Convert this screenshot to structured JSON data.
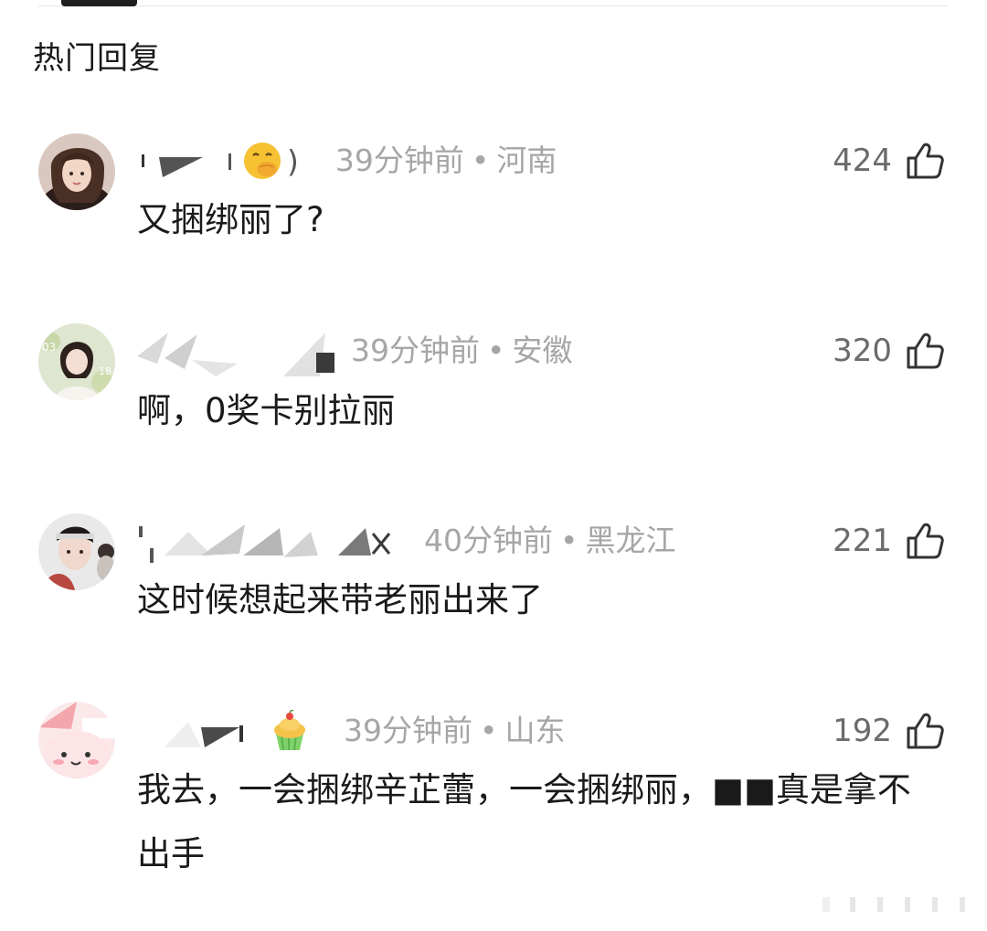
{
  "section_title": "热门回复",
  "comments": [
    {
      "time": "39分钟前",
      "dot": "•",
      "location": "河南",
      "likes": "424",
      "text": "又捆绑丽了?",
      "avatar_desc": "woman-long-hair-avatar",
      "username_emoji": "hand-over-mouth-emoji"
    },
    {
      "time": "39分钟前",
      "dot": "•",
      "location": "安徽",
      "likes": "320",
      "text": "啊，0奖卡别拉丽",
      "avatar_desc": "girl-portrait-avatar"
    },
    {
      "time": "40分钟前",
      "dot": "•",
      "location": "黑龙江",
      "likes": "221",
      "text": "这时候想起来带老丽出来了",
      "avatar_desc": "young-man-headband-avatar"
    },
    {
      "time": "39分钟前",
      "dot": "•",
      "location": "山东",
      "likes": "192",
      "text": "我去，一会捆绑辛芷蕾，一会捆绑丽，■■真是拿不出手",
      "avatar_desc": "pink-cartoon-avatar",
      "username_emoji": "cupcake-emoji"
    }
  ],
  "colors": {
    "meta_gray": "#a6a6a6",
    "like_gray": "#6b6b6b",
    "text": "#1a1a1a"
  }
}
